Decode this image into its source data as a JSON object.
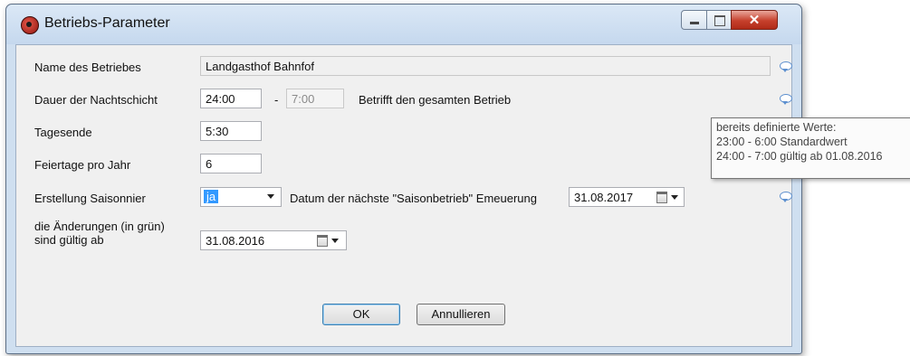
{
  "window": {
    "title": "Betriebs-Parameter",
    "close_glyph": "✕"
  },
  "form": {
    "name": {
      "label": "Name des Betriebes",
      "value": "Landgasthof Bahnfof"
    },
    "nightshift": {
      "label": "Dauer der Nachtschicht",
      "from": "24:00",
      "separator": "-",
      "to": "7:00",
      "note": "Betrifft den gesamten Betrieb"
    },
    "dayend": {
      "label": "Tagesende",
      "value": "5:30"
    },
    "holidays": {
      "label": "Feiertage pro Jahr",
      "value": "6"
    },
    "seasonal": {
      "label": "Erstellung Saisonnier",
      "value": "ja",
      "date_label": "Datum der nächste \"Saisonbetrieb\" Emeuerung",
      "date_value": "31.08.2017"
    },
    "changes": {
      "label_line1": "die Änderungen (in grün)",
      "label_line2": "sind gültig ab",
      "date_value": "31.08.2016"
    }
  },
  "buttons": {
    "ok": "OK",
    "cancel": "Annullieren"
  },
  "tooltip": {
    "line1": "bereits definierte Werte:",
    "line2": "23:00 - 6:00 Standardwert",
    "line3": "24:00 - 7:00 gültig ab 01.08.2016"
  },
  "icons": [
    "app-icon",
    "minimize-icon",
    "maximize-icon",
    "close-icon",
    "comment-icon",
    "dropdown-arrow-icon",
    "calendar-icon"
  ]
}
